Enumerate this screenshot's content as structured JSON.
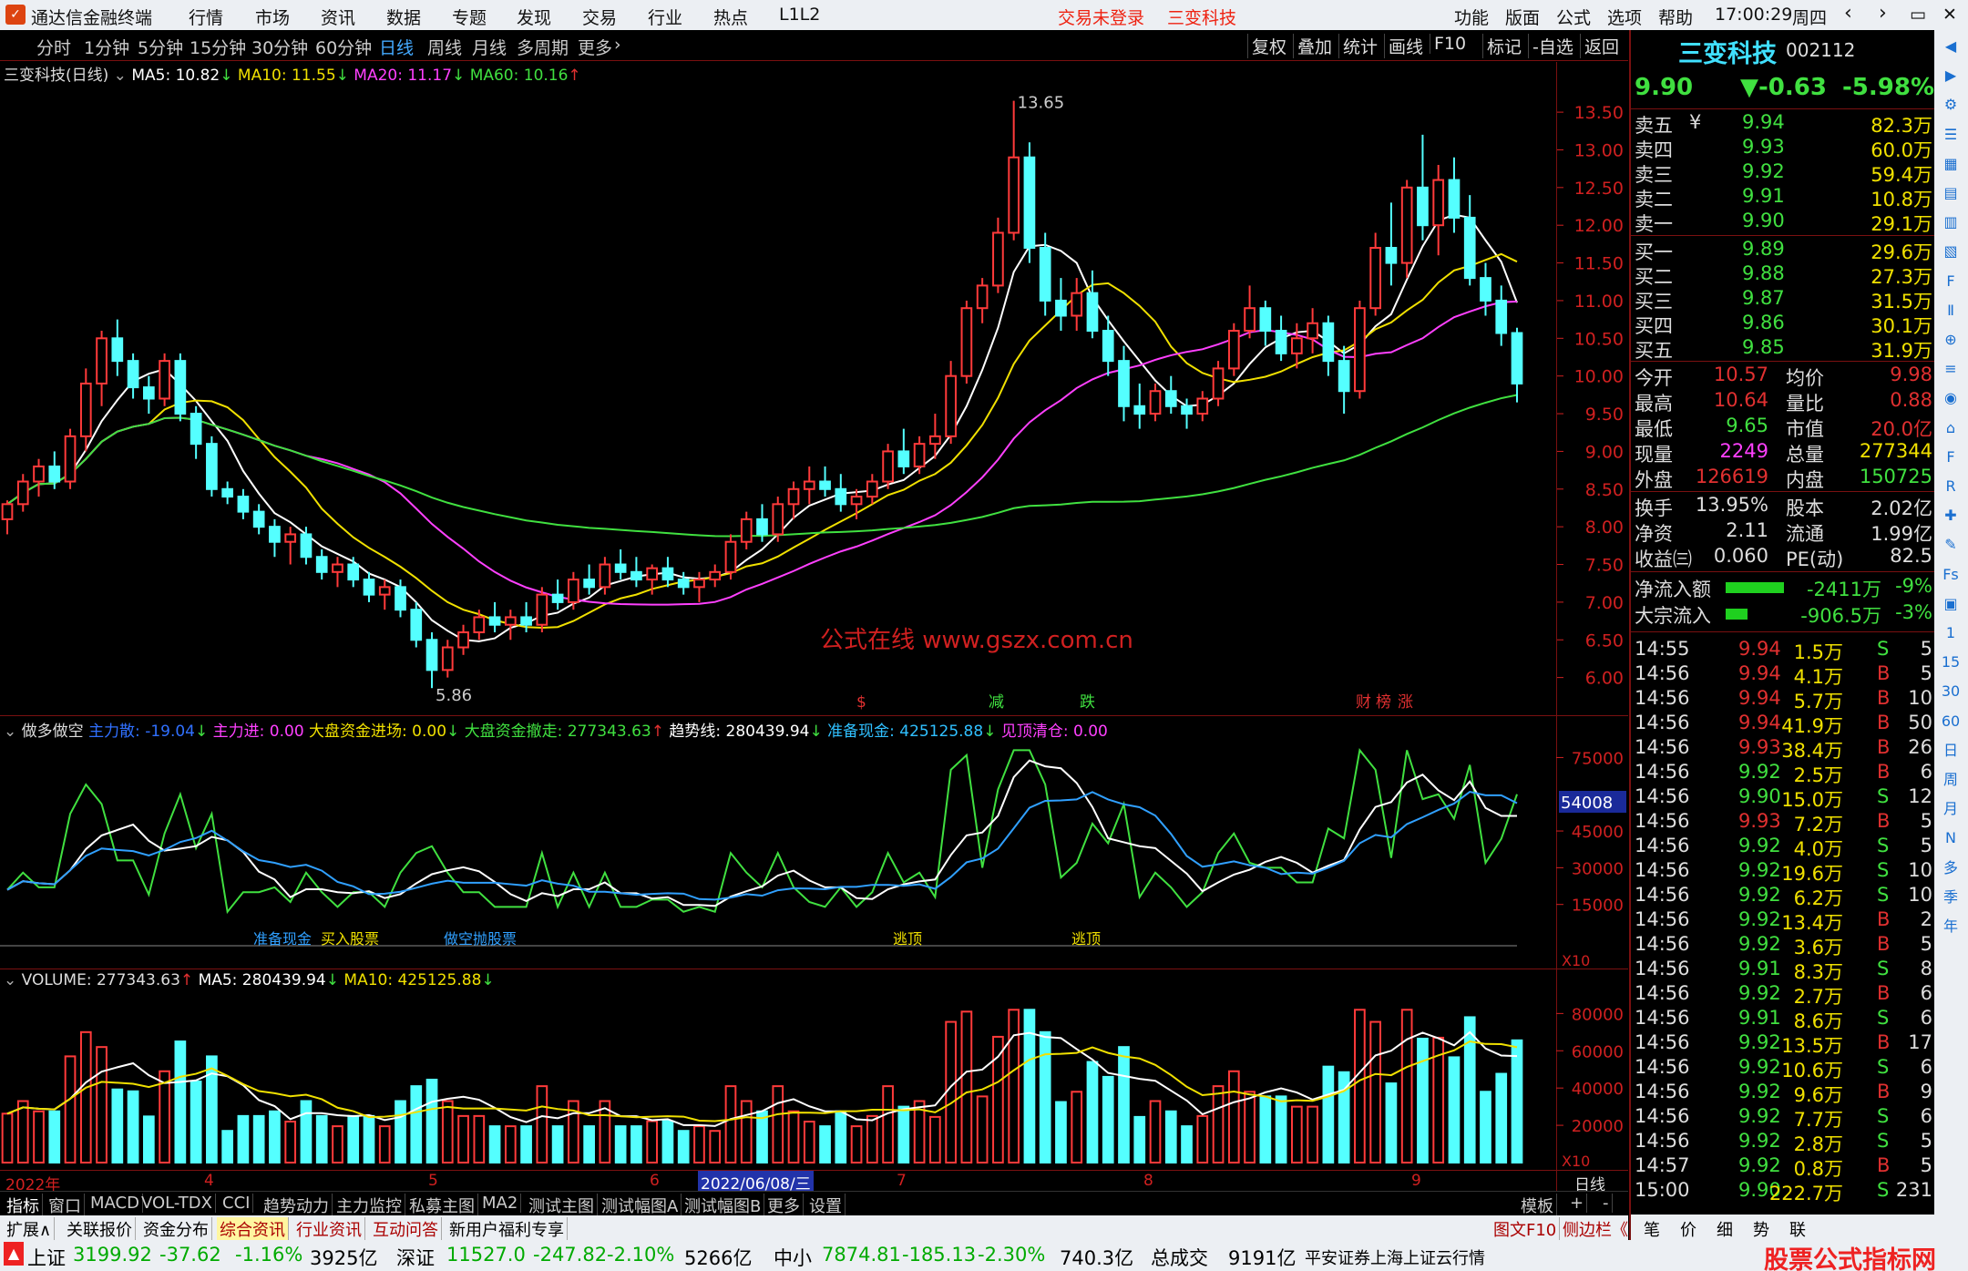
{
  "menubar": {
    "app_title": "通达信金融终端",
    "menus": [
      "行情",
      "市场",
      "资讯",
      "数据",
      "专题",
      "发现",
      "交易",
      "行业",
      "热点",
      "L1L2"
    ],
    "trade_status": "交易未登录",
    "stock_name": "三变科技",
    "right_menus": [
      "功能",
      "版面",
      "公式",
      "选项",
      "帮助"
    ],
    "time": "17:00:29",
    "weekday": "周四",
    "win_buttons": [
      "‹",
      "›",
      "▭",
      "✕"
    ]
  },
  "toolbar": {
    "periods": [
      "分时",
      "1分钟",
      "5分钟",
      "15分钟",
      "30分钟",
      "60分钟",
      "日线",
      "周线",
      "月线",
      "多周期",
      "更多"
    ],
    "active": "日线",
    "more_arrow": "›",
    "actions": [
      "复权",
      "叠加",
      "统计",
      "画线",
      "F10",
      "标记",
      "-自选",
      "返回"
    ]
  },
  "main_chart": {
    "title": "三变科技(日线)",
    "ma": [
      {
        "label": "MA5: 10.82",
        "arrow": "↓",
        "color": "#ffffff"
      },
      {
        "label": "MA10: 11.55",
        "arrow": "↓",
        "color": "#f0e000"
      },
      {
        "label": "MA20: 11.17",
        "arrow": "↓",
        "color": "#ff40ff"
      },
      {
        "label": "MA60: 10.16",
        "arrow": "↑",
        "color": "#40e040"
      }
    ],
    "high_label": "13.65",
    "low_label": "5.86",
    "yticks": [
      "13.50",
      "13.00",
      "12.50",
      "12.00",
      "11.50",
      "11.00",
      "10.50",
      "10.00",
      "9.50",
      "9.00",
      "8.50",
      "8.00",
      "7.50",
      "7.00",
      "6.50",
      "6.00"
    ],
    "watermark": "公式在线 www.gszx.com.cn",
    "markers": [
      {
        "text": "$",
        "color": "#e03030"
      },
      {
        "text": "减",
        "color": "#40e040"
      },
      {
        "text": "跌",
        "color": "#40e040"
      },
      {
        "text": "财",
        "color": "#e03030"
      },
      {
        "text": "榜",
        "color": "#e03030"
      },
      {
        "text": "涨",
        "color": "#e03030"
      }
    ]
  },
  "chart_data": {
    "type": "candlestick",
    "title": "三变科技(日线)",
    "ylim": [
      5.5,
      13.9
    ],
    "high": 13.65,
    "low": 5.86,
    "last_close": 9.9,
    "ma": {
      "MA5": 10.82,
      "MA10": 11.55,
      "MA20": 11.17,
      "MA60": 10.16
    },
    "x_labels": [
      "2022年",
      "4",
      "5",
      "6",
      "2022/06/08/三",
      "7",
      "8",
      "9"
    ],
    "ohlc": [
      [
        8.1,
        8.35,
        7.9,
        8.3
      ],
      [
        8.3,
        8.7,
        8.2,
        8.6
      ],
      [
        8.6,
        8.9,
        8.4,
        8.8
      ],
      [
        8.8,
        9.0,
        8.5,
        8.6
      ],
      [
        8.6,
        9.3,
        8.5,
        9.2
      ],
      [
        9.2,
        10.1,
        9.0,
        9.9
      ],
      [
        9.9,
        10.6,
        9.6,
        10.5
      ],
      [
        10.5,
        10.75,
        10.0,
        10.2
      ],
      [
        10.2,
        10.3,
        9.7,
        9.85
      ],
      [
        9.85,
        10.0,
        9.5,
        9.7
      ],
      [
        9.7,
        10.3,
        9.6,
        10.2
      ],
      [
        10.2,
        10.3,
        9.4,
        9.5
      ],
      [
        9.5,
        9.6,
        8.9,
        9.1
      ],
      [
        9.1,
        9.2,
        8.4,
        8.5
      ],
      [
        8.5,
        8.6,
        8.3,
        8.4
      ],
      [
        8.4,
        8.5,
        8.1,
        8.2
      ],
      [
        8.2,
        8.3,
        7.9,
        8.0
      ],
      [
        8.0,
        8.1,
        7.6,
        7.8
      ],
      [
        7.8,
        8.0,
        7.5,
        7.9
      ],
      [
        7.9,
        8.0,
        7.5,
        7.6
      ],
      [
        7.6,
        7.7,
        7.3,
        7.4
      ],
      [
        7.4,
        7.6,
        7.2,
        7.5
      ],
      [
        7.5,
        7.6,
        7.2,
        7.3
      ],
      [
        7.3,
        7.4,
        7.0,
        7.1
      ],
      [
        7.1,
        7.3,
        6.9,
        7.2
      ],
      [
        7.2,
        7.3,
        6.8,
        6.9
      ],
      [
        6.9,
        7.0,
        6.4,
        6.5
      ],
      [
        6.5,
        6.6,
        5.86,
        6.1
      ],
      [
        6.1,
        6.5,
        6.0,
        6.4
      ],
      [
        6.4,
        6.7,
        6.3,
        6.6
      ],
      [
        6.6,
        6.9,
        6.5,
        6.8
      ],
      [
        6.8,
        7.0,
        6.6,
        6.7
      ],
      [
        6.7,
        6.9,
        6.5,
        6.8
      ],
      [
        6.8,
        7.0,
        6.6,
        6.7
      ],
      [
        6.7,
        7.2,
        6.6,
        7.1
      ],
      [
        7.1,
        7.3,
        6.9,
        7.0
      ],
      [
        7.0,
        7.4,
        6.9,
        7.3
      ],
      [
        7.3,
        7.5,
        7.1,
        7.2
      ],
      [
        7.2,
        7.6,
        7.1,
        7.5
      ],
      [
        7.5,
        7.7,
        7.3,
        7.4
      ],
      [
        7.4,
        7.6,
        7.2,
        7.3
      ],
      [
        7.3,
        7.5,
        7.1,
        7.45
      ],
      [
        7.45,
        7.6,
        7.2,
        7.3
      ],
      [
        7.3,
        7.4,
        7.1,
        7.2
      ],
      [
        7.2,
        7.4,
        7.0,
        7.3
      ],
      [
        7.3,
        7.5,
        7.2,
        7.4
      ],
      [
        7.4,
        7.9,
        7.3,
        7.8
      ],
      [
        7.8,
        8.2,
        7.7,
        8.1
      ],
      [
        8.1,
        8.3,
        7.8,
        7.9
      ],
      [
        7.9,
        8.4,
        7.8,
        8.3
      ],
      [
        8.3,
        8.6,
        8.1,
        8.5
      ],
      [
        8.5,
        8.8,
        8.3,
        8.6
      ],
      [
        8.6,
        8.8,
        8.4,
        8.5
      ],
      [
        8.5,
        8.7,
        8.2,
        8.3
      ],
      [
        8.3,
        8.5,
        8.1,
        8.4
      ],
      [
        8.4,
        8.7,
        8.3,
        8.6
      ],
      [
        8.6,
        9.1,
        8.5,
        9.0
      ],
      [
        9.0,
        9.3,
        8.7,
        8.8
      ],
      [
        8.8,
        9.2,
        8.7,
        9.1
      ],
      [
        9.1,
        9.5,
        8.9,
        9.2
      ],
      [
        9.2,
        10.2,
        9.1,
        10.0
      ],
      [
        10.0,
        11.0,
        9.9,
        10.9
      ],
      [
        10.9,
        11.3,
        10.7,
        11.2
      ],
      [
        11.2,
        12.1,
        11.1,
        11.9
      ],
      [
        11.9,
        13.65,
        11.8,
        12.9
      ],
      [
        12.9,
        13.1,
        11.5,
        11.7
      ],
      [
        11.7,
        11.9,
        10.8,
        11.0
      ],
      [
        11.0,
        11.3,
        10.6,
        10.8
      ],
      [
        10.8,
        11.3,
        10.6,
        11.1
      ],
      [
        11.1,
        11.4,
        10.5,
        10.6
      ],
      [
        10.6,
        10.8,
        10.0,
        10.2
      ],
      [
        10.2,
        10.4,
        9.4,
        9.6
      ],
      [
        9.6,
        9.9,
        9.3,
        9.5
      ],
      [
        9.5,
        9.9,
        9.4,
        9.8
      ],
      [
        9.8,
        10.0,
        9.5,
        9.6
      ],
      [
        9.6,
        9.7,
        9.3,
        9.5
      ],
      [
        9.5,
        9.8,
        9.4,
        9.7
      ],
      [
        9.7,
        10.2,
        9.6,
        10.1
      ],
      [
        10.1,
        10.7,
        10.0,
        10.6
      ],
      [
        10.6,
        11.2,
        10.5,
        10.9
      ],
      [
        10.9,
        11.0,
        10.4,
        10.6
      ],
      [
        10.6,
        10.8,
        10.2,
        10.3
      ],
      [
        10.3,
        10.7,
        10.1,
        10.5
      ],
      [
        10.5,
        10.9,
        10.3,
        10.7
      ],
      [
        10.7,
        10.8,
        10.0,
        10.2
      ],
      [
        10.2,
        10.4,
        9.5,
        9.8
      ],
      [
        9.8,
        11.0,
        9.7,
        10.9
      ],
      [
        10.9,
        11.9,
        10.8,
        11.7
      ],
      [
        11.7,
        12.3,
        11.2,
        11.5
      ],
      [
        11.5,
        12.6,
        11.3,
        12.5
      ],
      [
        12.5,
        13.2,
        11.8,
        12.0
      ],
      [
        12.0,
        12.8,
        11.6,
        12.6
      ],
      [
        12.6,
        12.9,
        11.9,
        12.1
      ],
      [
        12.1,
        12.4,
        11.2,
        11.3
      ],
      [
        11.3,
        11.5,
        10.8,
        11.0
      ],
      [
        11.0,
        11.2,
        10.4,
        10.57
      ],
      [
        10.57,
        10.64,
        9.65,
        9.9
      ]
    ]
  },
  "indicator": {
    "title": "做多做空",
    "items": [
      {
        "label": "主力散: -19.04",
        "arrow": "↓",
        "color": "#3070ff"
      },
      {
        "label": "主力进: 0.00",
        "arrow": "",
        "color": "#ff40ff"
      },
      {
        "label": "大盘资金进场: 0.00",
        "arrow": "↓",
        "color": "#f0e000"
      },
      {
        "label": "大盘资金撤走: 277343.63",
        "arrow": "↑",
        "color": "#40e040"
      },
      {
        "label": "趋势线: 280439.94",
        "arrow": "↓",
        "color": "#ffffff"
      },
      {
        "label": "准备现金: 425125.88",
        "arrow": "↓",
        "color": "#30c0ff"
      },
      {
        "label": "见顶清仓: 0.00",
        "arrow": "",
        "color": "#ff40ff"
      }
    ],
    "yticks": [
      "75000",
      "45000",
      "30000",
      "15000"
    ],
    "current": "54008",
    "scale": "X10",
    "labels": [
      "准备现金",
      "买入股票",
      "做空抛股票",
      "逃顶",
      "逃顶"
    ]
  },
  "volume": {
    "title": "VOLUME: 277343.63",
    "arrow": "↑",
    "ma5": "MA5: 280439.94",
    "ma5_arrow": "↓",
    "ma10": "MA10: 425125.88",
    "ma10_arrow": "↓",
    "yticks": [
      "80000",
      "60000",
      "40000",
      "20000"
    ],
    "scale": "X10"
  },
  "quote": {
    "name": "三变科技",
    "code": "002112",
    "price": "9.90",
    "change": "▼-0.63",
    "pct": "-5.98%",
    "asks": [
      [
        "卖五",
        "9.94",
        "82.3万"
      ],
      [
        "卖四",
        "9.93",
        "60.0万"
      ],
      [
        "卖三",
        "9.92",
        "59.4万"
      ],
      [
        "卖二",
        "9.91",
        "10.8万"
      ],
      [
        "卖一",
        "9.90",
        "29.1万"
      ]
    ],
    "ask_five_suffix": "¥",
    "bids": [
      [
        "买一",
        "9.89",
        "29.6万"
      ],
      [
        "买二",
        "9.88",
        "27.3万"
      ],
      [
        "买三",
        "9.87",
        "31.5万"
      ],
      [
        "买四",
        "9.86",
        "30.1万"
      ],
      [
        "买五",
        "9.85",
        "31.9万"
      ]
    ],
    "stats": [
      [
        "今开",
        "10.57",
        "均价",
        "9.98"
      ],
      [
        "最高",
        "10.64",
        "量比",
        "0.88"
      ],
      [
        "最低",
        "9.65",
        "市值",
        "20.0亿"
      ],
      [
        "现量",
        "2249",
        "总量",
        "277344"
      ],
      [
        "外盘",
        "126619",
        "内盘",
        "150725"
      ]
    ],
    "fin": [
      [
        "换手",
        "13.95%",
        "股本",
        "2.02亿"
      ],
      [
        "净资",
        "2.11",
        "流通",
        "1.99亿"
      ],
      [
        "收益㈢",
        "0.060",
        "PE(动)",
        "82.5"
      ]
    ],
    "flows": [
      [
        "净流入额",
        "-2411万",
        "-9%"
      ],
      [
        "大宗流入",
        "-906.5万",
        "-3%"
      ]
    ],
    "ticks": [
      [
        "14:55",
        "9.94",
        "1.5万",
        "S",
        "5"
      ],
      [
        "14:56",
        "9.94",
        "4.1万",
        "B",
        "5"
      ],
      [
        "14:56",
        "9.94",
        "5.7万",
        "B",
        "10"
      ],
      [
        "14:56",
        "9.94",
        "41.9万",
        "B",
        "50"
      ],
      [
        "14:56",
        "9.93",
        "38.4万",
        "B",
        "26"
      ],
      [
        "14:56",
        "9.92",
        "2.5万",
        "B",
        "6"
      ],
      [
        "14:56",
        "9.90",
        "15.0万",
        "S",
        "12"
      ],
      [
        "14:56",
        "9.93",
        "7.2万",
        "B",
        "5"
      ],
      [
        "14:56",
        "9.92",
        "4.0万",
        "S",
        "5"
      ],
      [
        "14:56",
        "9.92",
        "19.6万",
        "S",
        "10"
      ],
      [
        "14:56",
        "9.92",
        "6.2万",
        "S",
        "10"
      ],
      [
        "14:56",
        "9.92",
        "13.4万",
        "B",
        "2"
      ],
      [
        "14:56",
        "9.92",
        "3.6万",
        "B",
        "5"
      ],
      [
        "14:56",
        "9.91",
        "8.3万",
        "S",
        "8"
      ],
      [
        "14:56",
        "9.92",
        "2.7万",
        "B",
        "6"
      ],
      [
        "14:56",
        "9.91",
        "8.6万",
        "S",
        "6"
      ],
      [
        "14:56",
        "9.92",
        "13.5万",
        "B",
        "17"
      ],
      [
        "14:56",
        "9.92",
        "10.6万",
        "S",
        "6"
      ],
      [
        "14:56",
        "9.92",
        "9.6万",
        "B",
        "9"
      ],
      [
        "14:56",
        "9.92",
        "7.7万",
        "S",
        "6"
      ],
      [
        "14:56",
        "9.92",
        "2.8万",
        "S",
        "5"
      ],
      [
        "14:57",
        "9.92",
        "0.8万",
        "B",
        "5"
      ],
      [
        "15:00",
        "9.90",
        "222.7万",
        "S",
        "231"
      ]
    ],
    "bottom_tabs": [
      "笔",
      "价",
      "细",
      "势",
      "联"
    ]
  },
  "side_icons": [
    "◀",
    "▶",
    "⚙",
    "☰",
    "▦",
    "▤",
    "▥",
    "▧",
    "F",
    "Ⅱ",
    "⊕",
    "≡",
    "◉",
    "⌂",
    "F",
    "R",
    "✚",
    "✎",
    "Fs",
    "▣",
    "1",
    "15",
    "30",
    "60",
    "日",
    "周",
    "月",
    "N",
    "多",
    "季",
    "年"
  ],
  "bottom": {
    "left_label": "日线",
    "tabs": [
      "指标",
      "窗口",
      "MACD",
      "VOL-TDX",
      "CCI",
      "趋势动力",
      "主力监控",
      "私募主图",
      "MA2",
      "测试主图",
      "测试幅图A",
      "测试幅图B",
      "更多",
      "设置"
    ],
    "right_label": "模板",
    "plus": "+",
    "minus": "-",
    "subtabs": [
      "扩展∧",
      "关联报价",
      "资金分布",
      "综合资讯",
      "行业资讯",
      "互动问答",
      "新用户福利专享"
    ],
    "right_sub": "图文F10",
    "side_bar": "侧边栏《"
  },
  "status": {
    "sh": [
      "上证",
      "3199.92",
      "-37.62",
      "-1.16%",
      "3925亿"
    ],
    "sz": [
      "深证",
      "11527.0",
      "-247.82",
      "-2.10%",
      "5266亿"
    ],
    "zx": [
      "中小",
      "7874.81",
      "-185.13",
      "-2.30%",
      "740.3亿"
    ],
    "total": [
      "总成交",
      "9191亿"
    ],
    "broker": "平安证券上海上证云行情",
    "brand": "股票公式指标网",
    "brand_url": "www.gszx.com.cn"
  }
}
